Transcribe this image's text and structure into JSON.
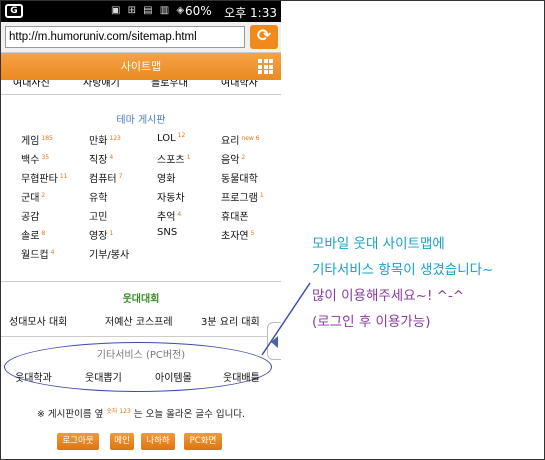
{
  "status": {
    "carrier_logo": "G",
    "battery": "60%",
    "time": "오후 1:33",
    "icons": "▣ ⊞ ▤ ▥ ◈"
  },
  "browser": {
    "url": "http://m.humoruniv.com/sitemap.html",
    "refresh_icon": "refresh-icon"
  },
  "title": {
    "label": "사이트맵",
    "menu_icon": "grid-menu-icon"
  },
  "cut_row": [
    "여대사진",
    "사랑얘기",
    "블로우대",
    "여대학사"
  ],
  "theme": {
    "title": "테마 게시판",
    "items": [
      {
        "label": "게임",
        "badge": "185"
      },
      {
        "label": "만화",
        "badge": "123"
      },
      {
        "label": "LOL",
        "badge": "12"
      },
      {
        "label": "요리",
        "badge": "new 6"
      },
      {
        "label": "백수",
        "badge": "35"
      },
      {
        "label": "직장",
        "badge": "4"
      },
      {
        "label": "스포츠",
        "badge": "1"
      },
      {
        "label": "음악",
        "badge": "2"
      },
      {
        "label": "무협판타",
        "badge": "11"
      },
      {
        "label": "컴퓨터",
        "badge": "7"
      },
      {
        "label": "영화",
        "badge": ""
      },
      {
        "label": "동물대학",
        "badge": ""
      },
      {
        "label": "군대",
        "badge": "2"
      },
      {
        "label": "유학",
        "badge": ""
      },
      {
        "label": "자동차",
        "badge": ""
      },
      {
        "label": "프로그램",
        "badge": "1"
      },
      {
        "label": "공감",
        "badge": ""
      },
      {
        "label": "고민",
        "badge": ""
      },
      {
        "label": "추억",
        "badge": "4"
      },
      {
        "label": "휴대폰",
        "badge": ""
      },
      {
        "label": "솔로",
        "badge": "8"
      },
      {
        "label": "영장",
        "badge": "1"
      },
      {
        "label": "SNS",
        "badge": ""
      },
      {
        "label": "초자연",
        "badge": "5"
      },
      {
        "label": "월드컵",
        "badge": "4"
      },
      {
        "label": "기부/봉사",
        "badge": ""
      }
    ]
  },
  "contest": {
    "title": "웃대대회",
    "items": [
      "성대모사 대회",
      "저예산 코스프레",
      "3분 요리 대회"
    ]
  },
  "services": {
    "title": "기타서비스 (PC버전)",
    "items": [
      "웃대학과",
      "웃대뽑기",
      "아이템몰",
      "웃대배틀"
    ]
  },
  "note": {
    "prefix": "※ 게시판이름 옆",
    "sample": "숫자 123",
    "suffix": "는 오늘 올라온 글수 입니다."
  },
  "buttons": [
    "로그아웃",
    "메인",
    "나하하",
    "PC화면"
  ],
  "annotation": {
    "line1": "모바일 웃대 사이트맵에",
    "line2": "기타서비스 항목이 생겼습니다~",
    "line3": "많이 이용해주세요~! ^-^",
    "line4": "(로그인 후 이용가능)",
    "colors": {
      "cyan": "#1a9fc9",
      "purple": "#8b3aa0"
    }
  },
  "colors": {
    "accent_orange": "#ea8a22",
    "theme_title": "#4a7bbf",
    "contest_title": "#3a8f2a"
  }
}
